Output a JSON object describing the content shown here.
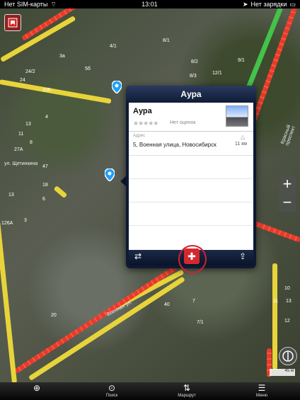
{
  "status_bar": {
    "carrier": "Нет SIM-карты",
    "time": "13:01",
    "charging": "Нет зарядки"
  },
  "map": {
    "road_labels": [
      "Красный проспект",
      "ул. Щетинкина",
      "Военная ул."
    ],
    "house_numbers": [
      "4/1",
      "8/1",
      "8/2",
      "8/3",
      "12/1",
      "24/2",
      "24",
      "3а",
      "5б",
      "100",
      "13",
      "11",
      "4",
      "8",
      "27А",
      "47",
      "18",
      "6",
      "13",
      "126А",
      "3",
      "10",
      "11",
      "12",
      "13",
      "40",
      "7",
      "7/1",
      "9/1",
      "20"
    ]
  },
  "popup": {
    "title": "Аура",
    "place_name": "Аура",
    "stars": "★★★★★",
    "rating_text": "Нет оценок",
    "address_label": "Адрес",
    "address_value": "5, Военная улица, Новосибирск",
    "distance": "11 км"
  },
  "map_controls": {
    "zoom_in": "+",
    "zoom_out": "−",
    "scale": "45 м"
  },
  "toolbar": {
    "items": [
      {
        "label": "",
        "icon": "locate-icon"
      },
      {
        "label": "Поиск",
        "icon": "search-icon"
      },
      {
        "label": "Маршрут",
        "icon": "route-icon"
      },
      {
        "label": "Меню",
        "icon": "menu-icon"
      }
    ]
  },
  "colors": {
    "traffic_heavy": "#e83a2c",
    "traffic_medium": "#e8d43a",
    "traffic_free": "#44c24a",
    "popup_bg": "#0e1a33",
    "favorite_red": "#d4282f"
  }
}
